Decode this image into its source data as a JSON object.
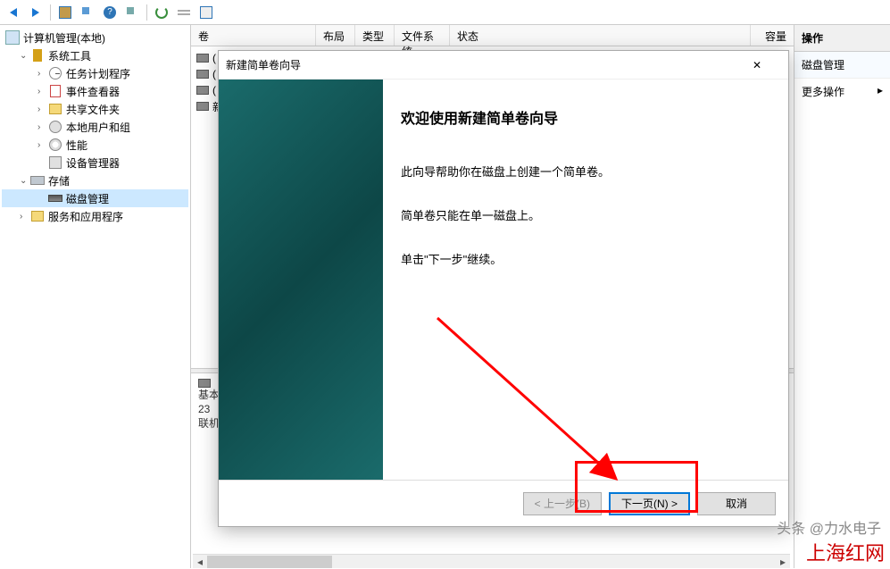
{
  "tree": {
    "root": "计算机管理(本地)",
    "system_tools": "系统工具",
    "task_scheduler": "任务计划程序",
    "event_viewer": "事件查看器",
    "shared_folders": "共享文件夹",
    "local_users": "本地用户和组",
    "performance": "性能",
    "device_manager": "设备管理器",
    "storage": "存储",
    "disk_management": "磁盘管理",
    "services_apps": "服务和应用程序"
  },
  "columns": {
    "volume": "卷",
    "layout": "布局",
    "type": "类型",
    "filesystem": "文件系统",
    "status": "状态",
    "capacity": "容量"
  },
  "volumes": [
    "(",
    "(",
    "(",
    "新"
  ],
  "bottom": {
    "l1": "基本",
    "l2": "23",
    "l3": "联机"
  },
  "right": {
    "title": "操作",
    "section": "磁盘管理",
    "more": "更多操作"
  },
  "dialog": {
    "title": "新建简单卷向导",
    "heading": "欢迎使用新建简单卷向导",
    "p1": "此向导帮助你在磁盘上创建一个简单卷。",
    "p2": "简单卷只能在单一磁盘上。",
    "p3": "单击\"下一步\"继续。",
    "back": "< 上一步(B)",
    "next": "下一页(N) >",
    "cancel": "取消"
  },
  "watermark1": "头条 @力水电子",
  "watermark2": "上海红网"
}
